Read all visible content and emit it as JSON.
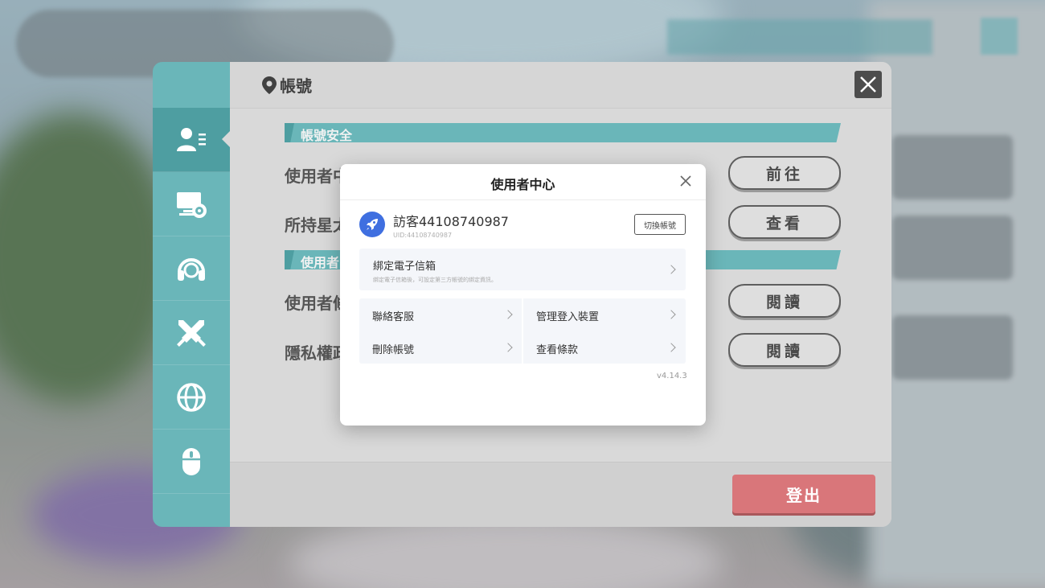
{
  "panel": {
    "title": "帳號",
    "section_security": "帳號安全",
    "section_user": "使用者",
    "rows": [
      {
        "label": "使用者中",
        "button": "前往"
      },
      {
        "label": "所持星太",
        "button": "查看"
      },
      {
        "label": "使用者條",
        "button": "閱讀"
      },
      {
        "label": "隱私權政",
        "button": "閱讀"
      }
    ],
    "logout": "登出"
  },
  "sidebar": {
    "items": [
      {
        "icon": "account-icon",
        "active": true
      },
      {
        "icon": "display-settings-icon"
      },
      {
        "icon": "headphones-icon"
      },
      {
        "icon": "crossed-swords-icon"
      },
      {
        "icon": "globe-icon"
      },
      {
        "icon": "mouse-icon"
      }
    ]
  },
  "dialog": {
    "title": "使用者中心",
    "username": "訪客44108740987",
    "uid": "UID:44108740987",
    "switch_account": "切換帳號",
    "email_title": "綁定電子信箱",
    "email_desc": "綁定電子信箱後，可設定第三方帳號的綁定資訊。",
    "items": {
      "support": "聯絡客服",
      "devices": "管理登入裝置",
      "delete": "刪除帳號",
      "terms": "查看條款"
    },
    "version": "v4.14.3"
  },
  "colors": {
    "teal": "#6ab6b9",
    "teal_dark": "#4e9ea1",
    "logout": "#d9767a",
    "avatar": "#3f6fe0"
  }
}
